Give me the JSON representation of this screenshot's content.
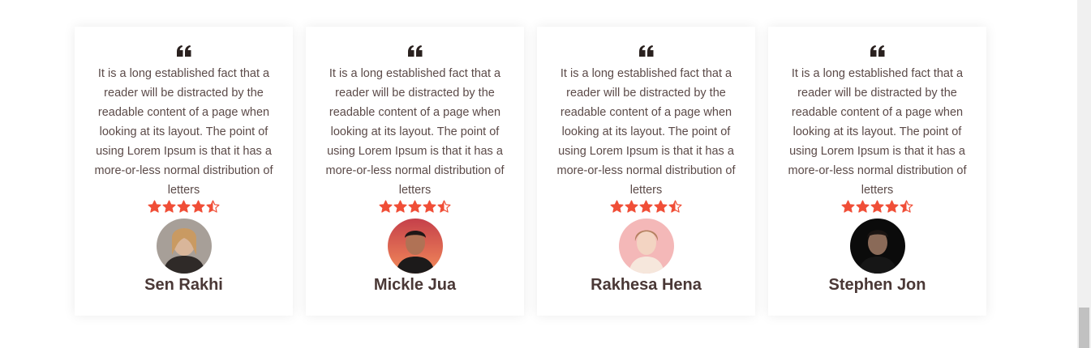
{
  "colors": {
    "star": "#f04e37",
    "name": "#4a3836",
    "text": "#5b4a48",
    "quote": "#2a211f"
  },
  "testimonials": [
    {
      "quote_icon": "quote-icon",
      "text": "It is a long established fact that a reader will be distracted by the readable content of a page when looking at its layout. The point of using Lorem Ipsum is that it has a more-or-less normal distribution of letters",
      "rating": 4.5,
      "name": "Sen Rakhi"
    },
    {
      "quote_icon": "quote-icon",
      "text": "It is a long established fact that a reader will be distracted by the readable content of a page when looking at its layout. The point of using Lorem Ipsum is that it has a more-or-less normal distribution of letters",
      "rating": 4.5,
      "name": "Mickle Jua"
    },
    {
      "quote_icon": "quote-icon",
      "text": "It is a long established fact that a reader will be distracted by the readable content of a page when looking at its layout. The point of using Lorem Ipsum is that it has a more-or-less normal distribution of letters",
      "rating": 4.5,
      "name": "Rakhesa Hena"
    },
    {
      "quote_icon": "quote-icon",
      "text": "It is a long established fact that a reader will be distracted by the readable content of a page when looking at its layout. The point of using Lorem Ipsum is that it has a more-or-less normal distribution of letters",
      "rating": 4.5,
      "name": "Stephen Jon"
    }
  ]
}
